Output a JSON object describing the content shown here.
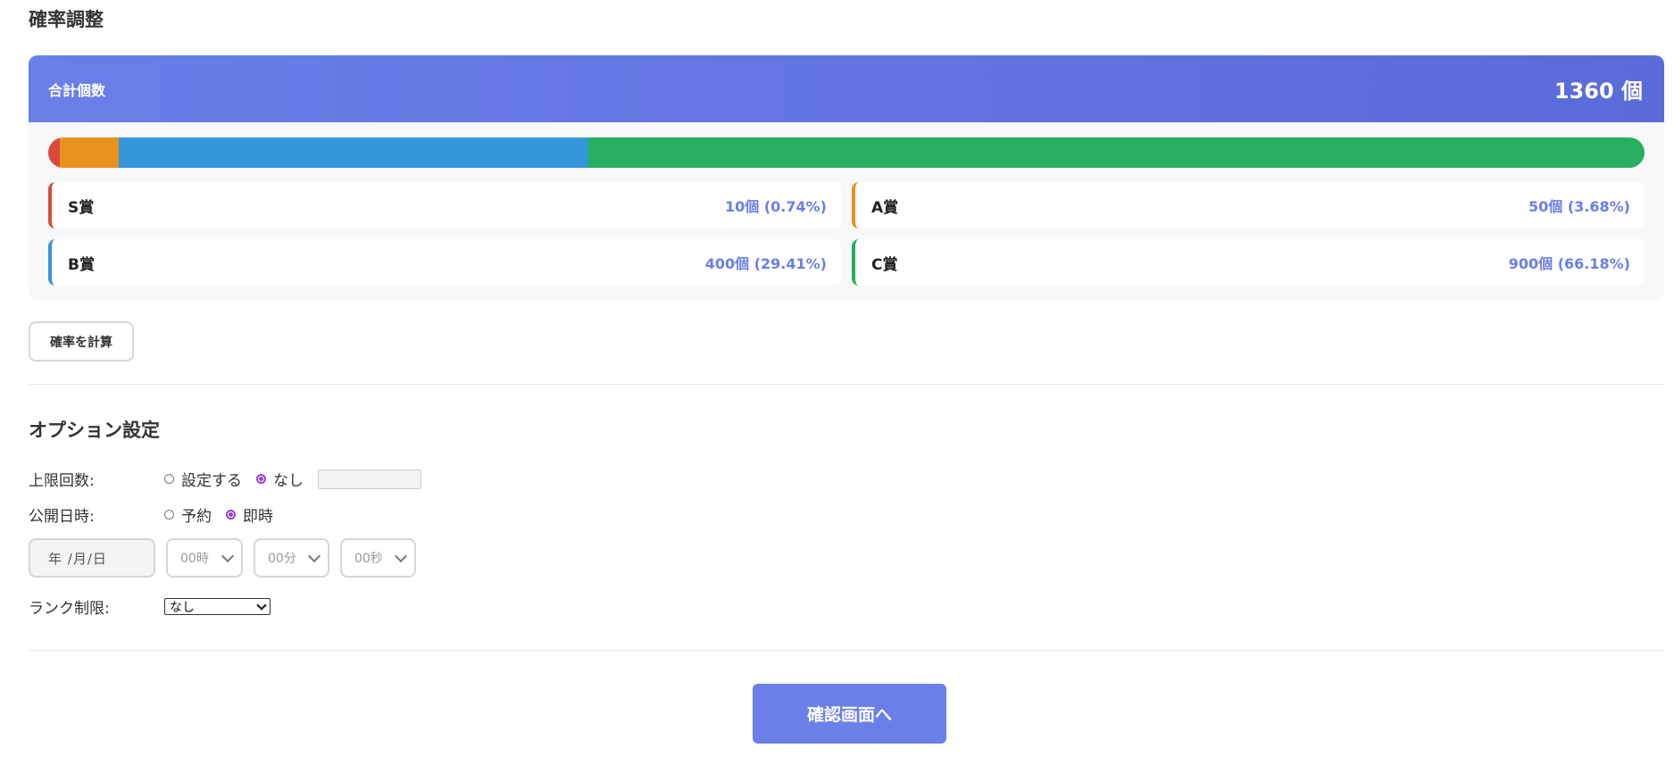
{
  "section": {
    "title": "確率調整"
  },
  "summary": {
    "label": "合計個数",
    "total": "1360 個"
  },
  "prizes": [
    {
      "name": "S賞",
      "stat": "10個 (0.74%)",
      "count": 10,
      "fraction": 0.0074,
      "color": "#d94a3a"
    },
    {
      "name": "A賞",
      "stat": "50個 (3.68%)",
      "count": 50,
      "fraction": 0.0368,
      "color": "#e8921e"
    },
    {
      "name": "B賞",
      "stat": "400個 (29.41%)",
      "count": 400,
      "fraction": 0.2941,
      "color": "#3497db"
    },
    {
      "name": "C賞",
      "stat": "900個 (66.18%)",
      "count": 900,
      "fraction": 0.6618,
      "color": "#27ae60"
    }
  ],
  "calc_button": {
    "label": "確率を計算"
  },
  "options": {
    "title": "オプション設定",
    "limit": {
      "label": "上限回数:",
      "opt_set": "設定する",
      "opt_none": "なし",
      "selected": "none",
      "value": ""
    },
    "publish": {
      "label": "公開日時:",
      "opt_reserve": "予約",
      "opt_now": "即時",
      "selected": "now"
    },
    "date": {
      "placeholder": "年 /月/日"
    },
    "hour": {
      "value": "00時"
    },
    "minute": {
      "value": "00分"
    },
    "second": {
      "value": "00秒"
    },
    "rank": {
      "label": "ランク制限:",
      "value": "なし"
    }
  },
  "confirm_button": {
    "label": "確認画面へ"
  },
  "colors": {
    "accent": "#6a7fe8",
    "radio_selected": "#9b3fd1"
  }
}
